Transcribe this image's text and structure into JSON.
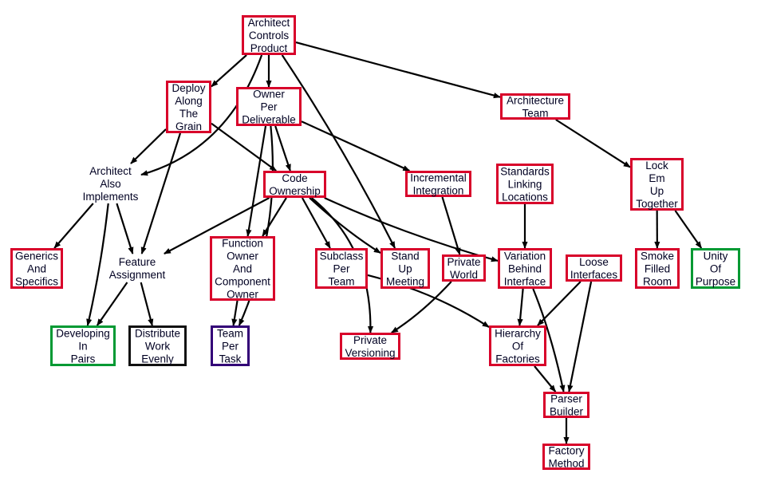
{
  "colors": {
    "red": "#d8002a",
    "green": "#009933",
    "purple": "#330077",
    "black": "#111111",
    "edge": "#000000"
  },
  "nodes": [
    {
      "id": "acp",
      "lines": [
        "Architect",
        "Controls",
        "Product"
      ],
      "border": "red"
    },
    {
      "id": "deploy",
      "lines": [
        "Deploy",
        "Along",
        "The",
        "Grain"
      ],
      "border": "red"
    },
    {
      "id": "ownerper",
      "lines": [
        "Owner",
        "Per",
        "Deliverable"
      ],
      "border": "red"
    },
    {
      "id": "archteam",
      "lines": [
        "Architecture",
        "Team"
      ],
      "border": "red"
    },
    {
      "id": "archalso",
      "lines": [
        "Architect",
        "Also",
        "Implements"
      ],
      "border": "none"
    },
    {
      "id": "codeown",
      "lines": [
        "Code",
        "Ownership"
      ],
      "border": "red"
    },
    {
      "id": "incr",
      "lines": [
        "Incremental",
        "Integration"
      ],
      "border": "red"
    },
    {
      "id": "standards",
      "lines": [
        "Standards",
        "Linking",
        "Locations"
      ],
      "border": "red"
    },
    {
      "id": "lockem",
      "lines": [
        "Lock",
        "Em",
        "Up",
        "Together"
      ],
      "border": "red"
    },
    {
      "id": "generics",
      "lines": [
        "Generics",
        "And",
        "Specifics"
      ],
      "border": "red"
    },
    {
      "id": "feature",
      "lines": [
        "Feature",
        "Assignment"
      ],
      "border": "none"
    },
    {
      "id": "funcowner",
      "lines": [
        "Function",
        "Owner",
        "And",
        "Component",
        "Owner"
      ],
      "border": "red"
    },
    {
      "id": "subclass",
      "lines": [
        "Subclass",
        "Per",
        "Team"
      ],
      "border": "red"
    },
    {
      "id": "standup",
      "lines": [
        "Stand",
        "Up",
        "Meeting"
      ],
      "border": "red"
    },
    {
      "id": "privworld",
      "lines": [
        "Private",
        "World"
      ],
      "border": "red"
    },
    {
      "id": "variation",
      "lines": [
        "Variation",
        "Behind",
        "Interface"
      ],
      "border": "red"
    },
    {
      "id": "loose",
      "lines": [
        "Loose",
        "Interfaces"
      ],
      "border": "red"
    },
    {
      "id": "smoke",
      "lines": [
        "Smoke",
        "Filled",
        "Room"
      ],
      "border": "red"
    },
    {
      "id": "unity",
      "lines": [
        "Unity",
        "Of",
        "Purpose"
      ],
      "border": "green"
    },
    {
      "id": "devpairs",
      "lines": [
        "Developing",
        "In",
        "Pairs"
      ],
      "border": "green"
    },
    {
      "id": "distribute",
      "lines": [
        "Distribute",
        "Work",
        "Evenly"
      ],
      "border": "black"
    },
    {
      "id": "teampertask",
      "lines": [
        "Team",
        "Per",
        "Task"
      ],
      "border": "purple"
    },
    {
      "id": "privvers",
      "lines": [
        "Private",
        "Versioning"
      ],
      "border": "red"
    },
    {
      "id": "hierarchy",
      "lines": [
        "Hierarchy",
        "Of",
        "Factories"
      ],
      "border": "red"
    },
    {
      "id": "parser",
      "lines": [
        "Parser",
        "Builder"
      ],
      "border": "red"
    },
    {
      "id": "factory",
      "lines": [
        "Factory",
        "Method"
      ],
      "border": "red"
    }
  ],
  "edges": [
    [
      "acp",
      "archalso"
    ],
    [
      "acp",
      "deploy"
    ],
    [
      "acp",
      "ownerper"
    ],
    [
      "acp",
      "standup"
    ],
    [
      "acp",
      "archteam"
    ],
    [
      "deploy",
      "archalso"
    ],
    [
      "deploy",
      "feature"
    ],
    [
      "deploy",
      "codeown"
    ],
    [
      "ownerper",
      "codeown"
    ],
    [
      "ownerper",
      "funcowner"
    ],
    [
      "ownerper",
      "teampertask"
    ],
    [
      "ownerper",
      "incr"
    ],
    [
      "archteam",
      "lockem"
    ],
    [
      "archalso",
      "generics"
    ],
    [
      "archalso",
      "devpairs"
    ],
    [
      "archalso",
      "feature"
    ],
    [
      "codeown",
      "feature"
    ],
    [
      "codeown",
      "funcowner"
    ],
    [
      "codeown",
      "subclass"
    ],
    [
      "codeown",
      "standup"
    ],
    [
      "codeown",
      "variation"
    ],
    [
      "codeown",
      "privvers"
    ],
    [
      "incr",
      "privworld"
    ],
    [
      "standards",
      "variation"
    ],
    [
      "lockem",
      "smoke"
    ],
    [
      "lockem",
      "unity"
    ],
    [
      "feature",
      "devpairs"
    ],
    [
      "feature",
      "distribute"
    ],
    [
      "funcowner",
      "teampertask"
    ],
    [
      "subclass",
      "hierarchy"
    ],
    [
      "privworld",
      "privvers"
    ],
    [
      "variation",
      "hierarchy"
    ],
    [
      "variation",
      "parser"
    ],
    [
      "loose",
      "hierarchy"
    ],
    [
      "loose",
      "parser"
    ],
    [
      "hierarchy",
      "parser"
    ],
    [
      "parser",
      "factory"
    ]
  ]
}
